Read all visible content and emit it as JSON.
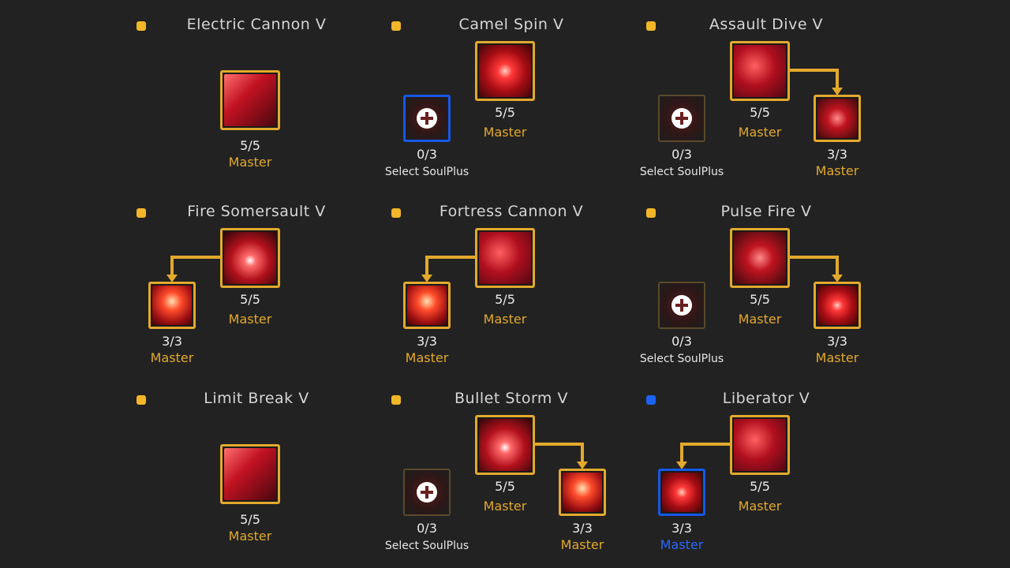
{
  "skills": [
    {
      "title": "Electric Cannon V",
      "dot": "gold",
      "main_level": "5/5",
      "main_label": "Master"
    },
    {
      "title": "Camel Spin V",
      "dot": "gold",
      "main_level": "5/5",
      "main_label": "Master",
      "side_level": "0/3",
      "side_label": "Select SoulPlus"
    },
    {
      "title": "Assault Dive V",
      "dot": "gold",
      "main_level": "5/5",
      "main_label": "Master",
      "side_level": "0/3",
      "side_label": "Select SoulPlus",
      "branch_level": "3/3",
      "branch_label": "Master"
    },
    {
      "title": "Fire Somersault V",
      "dot": "gold",
      "main_level": "5/5",
      "main_label": "Master",
      "branch_level": "3/3",
      "branch_label": "Master"
    },
    {
      "title": "Fortress Cannon V",
      "dot": "gold",
      "main_level": "5/5",
      "main_label": "Master",
      "branch_level": "3/3",
      "branch_label": "Master"
    },
    {
      "title": "Pulse Fire V",
      "dot": "gold",
      "main_level": "5/5",
      "main_label": "Master",
      "side_level": "0/3",
      "side_label": "Select SoulPlus",
      "branch_level": "3/3",
      "branch_label": "Master"
    },
    {
      "title": "Limit Break V",
      "dot": "gold",
      "main_level": "5/5",
      "main_label": "Master"
    },
    {
      "title": "Bullet Storm V",
      "dot": "gold",
      "main_level": "5/5",
      "main_label": "Master",
      "side_level": "0/3",
      "side_label": "Select SoulPlus",
      "branch_level": "3/3",
      "branch_label": "Master"
    },
    {
      "title": "Liberator V",
      "dot": "blue",
      "main_level": "5/5",
      "main_label": "Master",
      "branch_level": "3/3",
      "branch_label": "Master"
    }
  ],
  "colors": {
    "gold": "#e3a92d",
    "blue": "#1a63f0",
    "background": "#222222"
  }
}
